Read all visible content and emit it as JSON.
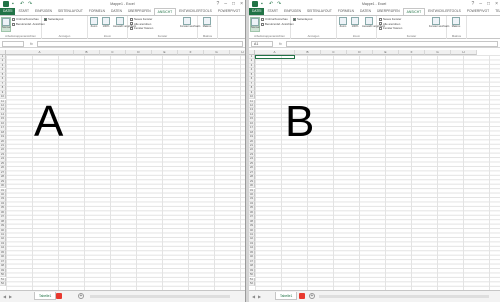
{
  "windows": [
    {
      "id": "A",
      "title": "Mappe1 - Excel",
      "tabs": [
        "DATEI",
        "START",
        "EINFÜGEN",
        "SEITENLAYOUT",
        "FORMELN",
        "DATEN",
        "ÜBERPRÜFEN",
        "ANSICHT",
        "ENTWICKLERTOOLS",
        "POWERPIVOT",
        "TEAM"
      ],
      "active_tab": "ANSICHT",
      "ribbon": {
        "normal_label": "Normal",
        "pagebreak_label": "Umbruchvorschau",
        "custom_views_label": "Benutzerdef. Ansichten",
        "layout_label": "Seitenlayout",
        "views_group": "Arbeitsmappenansichten",
        "show_group": "Anzeigen",
        "zoom_label": "Zoom",
        "zoom100_label": "100%",
        "zoom_sel_label": "Auswahl vergrößern",
        "zoom_group": "Zoom",
        "new_window": "Neues Fenster",
        "arrange_all": "Alle anordnen",
        "freeze": "Fenster fixieren",
        "window_group": "Fenster",
        "switch_window": "Fenster wechseln",
        "macros_label": "Makros",
        "macros_group": "Makros"
      },
      "namebox": "",
      "columns": [
        "A",
        "B",
        "C",
        "D",
        "E",
        "F",
        "G",
        "H"
      ],
      "rows": [
        "1",
        "2",
        "3",
        "4",
        "5",
        "6",
        "7",
        "8",
        "9",
        "10",
        "11",
        "12",
        "13",
        "14",
        "15",
        "16",
        "17",
        "18",
        "19",
        "20",
        "21",
        "22",
        "23",
        "24",
        "25",
        "26",
        "27",
        "28",
        "29",
        "30",
        "31",
        "32",
        "33",
        "34",
        "35",
        "36",
        "37",
        "38",
        "39",
        "40",
        "41",
        "42",
        "43",
        "44",
        "45",
        "46",
        "47",
        "48",
        "49",
        "50",
        "51",
        "52"
      ],
      "big_letter": "A",
      "sheet_tab": "Tabelle1",
      "fx": "fx"
    },
    {
      "id": "B",
      "title": "Mappe1 - Excel",
      "tabs": [
        "DATEI",
        "START",
        "EINFÜGEN",
        "SEITENLAYOUT",
        "FORMELN",
        "DATEN",
        "ÜBERPRÜFEN",
        "ANSICHT",
        "ENTWICKLERTOOLS",
        "POWERPIVOT",
        "TEAM"
      ],
      "active_tab": "ANSICHT",
      "ribbon": {
        "normal_label": "Normal",
        "pagebreak_label": "Umbruchvorschau",
        "custom_views_label": "Benutzerdef. Ansichten",
        "layout_label": "Seitenlayout",
        "views_group": "Arbeitsmappenansichten",
        "show_group": "Anzeigen",
        "zoom_label": "Zoom",
        "zoom100_label": "100%",
        "zoom_sel_label": "Auswahl vergrößern",
        "zoom_group": "Zoom",
        "new_window": "Neues Fenster",
        "arrange_all": "Alle anordnen",
        "freeze": "Fenster fixieren",
        "window_group": "Fenster",
        "switch_window": "Fenster wechseln",
        "macros_label": "Makros",
        "macros_group": "Makros"
      },
      "namebox": "A1",
      "columns": [
        "A",
        "B",
        "C",
        "D",
        "E",
        "F",
        "G",
        "H"
      ],
      "rows": [
        "1",
        "2",
        "3",
        "4",
        "5",
        "6",
        "7",
        "8",
        "9",
        "10",
        "11",
        "12",
        "13",
        "14",
        "15",
        "16",
        "17",
        "18",
        "19",
        "20",
        "21",
        "22",
        "23",
        "24",
        "25",
        "26",
        "27",
        "28",
        "29",
        "30",
        "31",
        "32",
        "33",
        "34",
        "35",
        "36",
        "37",
        "38",
        "39",
        "40",
        "41",
        "42",
        "43",
        "44",
        "45",
        "46",
        "47",
        "48",
        "49",
        "50",
        "51",
        "52"
      ],
      "big_letter": "B",
      "sheet_tab": "Tabelle1",
      "fx": "fx"
    }
  ],
  "colors": {
    "accent": "#217346",
    "badge": "#e8392f"
  },
  "icons": [
    "save-icon",
    "undo-icon",
    "redo-icon",
    "help-icon",
    "minimize-icon",
    "maximize-icon",
    "close-icon",
    "add-sheet-icon"
  ]
}
